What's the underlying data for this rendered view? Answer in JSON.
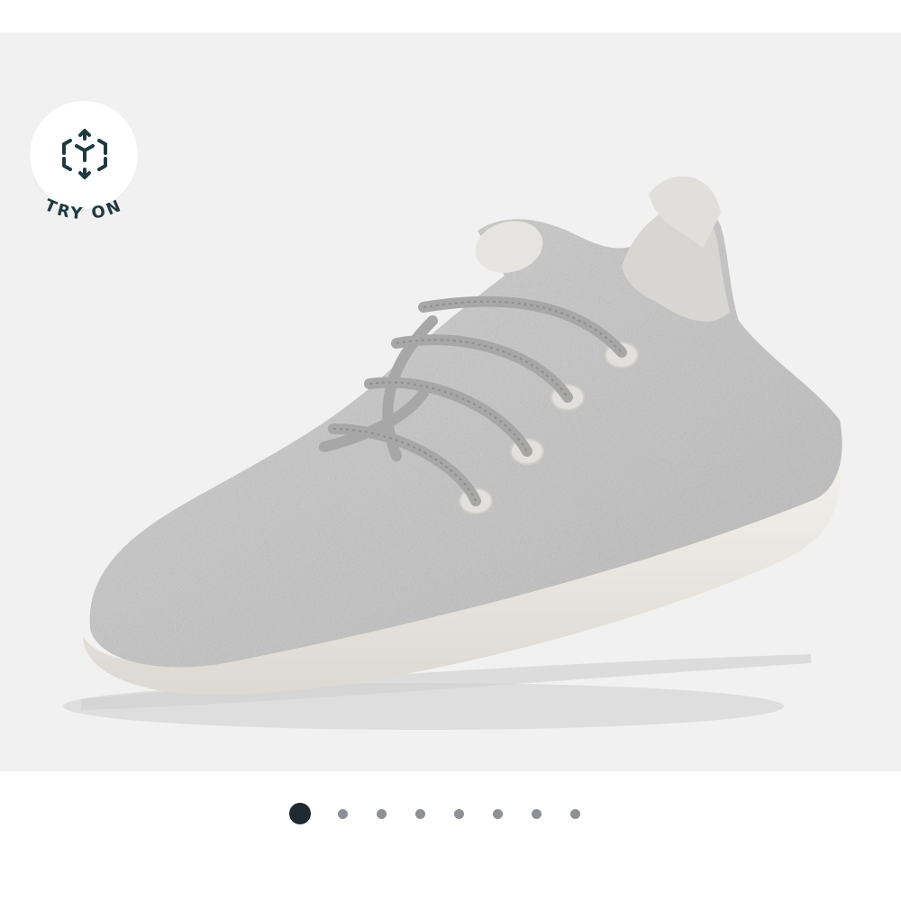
{
  "try_on": {
    "label": "TRY ON",
    "icon": "ar-cube-icon"
  },
  "carousel": {
    "slide_count": 8,
    "active_index": 0
  },
  "colors": {
    "gallery_background": "#f1f1f1",
    "try_on_text": "#1e3a40",
    "dot_active": "#1f2a33",
    "dot_inactive": "#8d9095"
  }
}
